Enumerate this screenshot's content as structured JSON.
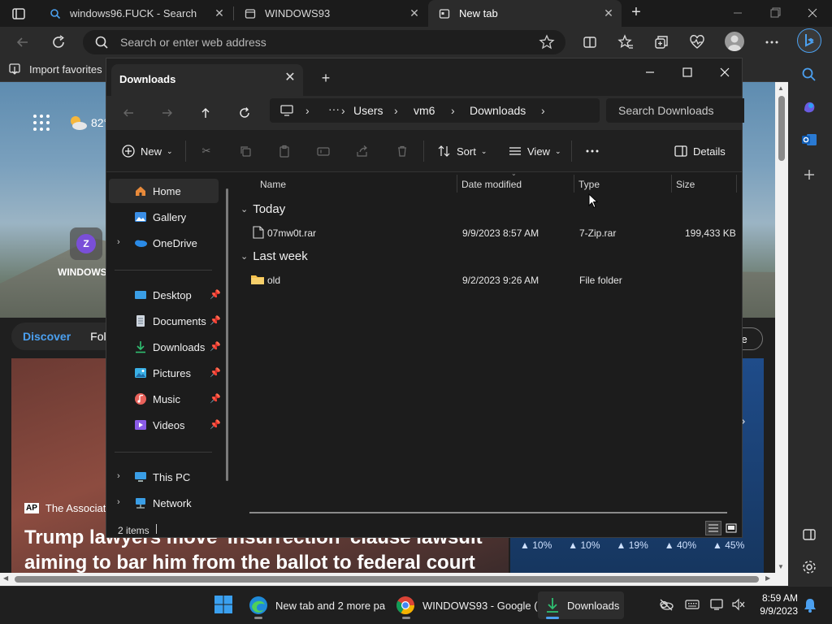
{
  "browser": {
    "tabs": [
      {
        "title": "windows96.FUCK - Search",
        "active": false
      },
      {
        "title": "WINDOWS93",
        "active": false
      },
      {
        "title": "New tab",
        "active": true
      }
    ],
    "address_placeholder": "Search or enter web address",
    "favorites_bar": {
      "import_label": "Import favorites"
    }
  },
  "newtab_page": {
    "weather_temp": "82°",
    "app_tile_letter": "Z",
    "app_tile_label": "WINDOWS",
    "feed_tabs": [
      "Discover",
      "Follo"
    ],
    "customize_label": "ze",
    "news_source": "The Associated",
    "news_source_logo": "AP",
    "headline": "Trump lawyers move 'insurrection' clause lawsuit aiming to bar him from the ballot to federal court",
    "market_values": [
      "10%",
      "10%",
      "19%",
      "40%",
      "45%"
    ]
  },
  "explorer": {
    "tab_title": "Downloads",
    "breadcrumbs": [
      "Users",
      "vm6",
      "Downloads"
    ],
    "search_placeholder": "Search Downloads",
    "commands": {
      "new": "New",
      "sort": "Sort",
      "view": "View",
      "details": "Details"
    },
    "nav_items": {
      "home": "Home",
      "gallery": "Gallery",
      "onedrive": "OneDrive",
      "desktop": "Desktop",
      "documents": "Documents",
      "downloads": "Downloads",
      "pictures": "Pictures",
      "music": "Music",
      "videos": "Videos",
      "thispc": "This PC",
      "network": "Network"
    },
    "columns": [
      "Name",
      "Date modified",
      "Type",
      "Size"
    ],
    "groups": [
      {
        "label": "Today",
        "items": [
          {
            "name": "07mw0t.rar",
            "date": "9/9/2023 8:57 AM",
            "type": "7-Zip.rar",
            "size": "199,433 KB"
          }
        ]
      },
      {
        "label": "Last week",
        "items": [
          {
            "name": "old",
            "date": "9/2/2023 9:26 AM",
            "type": "File folder",
            "size": ""
          }
        ]
      }
    ],
    "status": "2 items"
  },
  "taskbar": {
    "edge_label": "New tab and 2 more pa",
    "chrome_label": "WINDOWS93 - Google (",
    "explorer_label": "Downloads",
    "time": "8:59 AM",
    "date": "9/9/2023"
  },
  "colors": {
    "accent": "#4ba0f0",
    "folder": "#f4c04d"
  }
}
